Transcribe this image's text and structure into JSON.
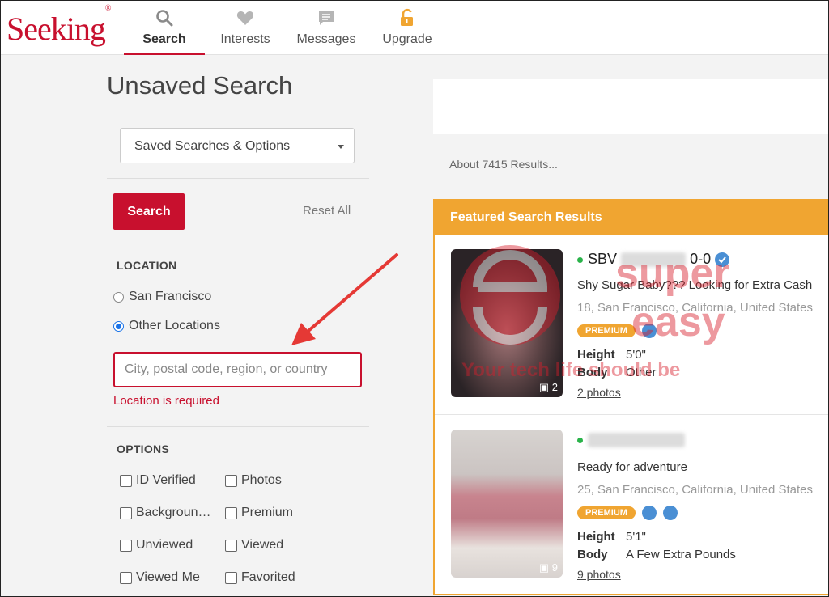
{
  "header": {
    "logo": "Seeking",
    "logo_mark": "®",
    "nav": [
      {
        "label": "Search",
        "icon": "search-icon"
      },
      {
        "label": "Interests",
        "icon": "heart-icon"
      },
      {
        "label": "Messages",
        "icon": "message-icon"
      },
      {
        "label": "Upgrade",
        "icon": "lock-icon"
      }
    ]
  },
  "left": {
    "title": "Unsaved Search",
    "dropdown_label": "Saved Searches & Options",
    "search_button": "Search",
    "reset_all": "Reset All",
    "location_label": "LOCATION",
    "radio_options": [
      "San Francisco",
      "Other Locations"
    ],
    "radio_selected": "Other Locations",
    "location_placeholder": "City, postal code, region, or country",
    "location_error": "Location is required",
    "options_label": "OPTIONS",
    "checkboxes": [
      "ID Verified",
      "Photos",
      "Backgroun…",
      "Premium",
      "Unviewed",
      "Viewed",
      "Viewed Me",
      "Favorited"
    ]
  },
  "right": {
    "results_count": "About 7415 Results...",
    "featured_title": "Featured Search Results",
    "cards": [
      {
        "username": "SBV",
        "username_suffix": "0-0",
        "headline": "Shy Sugar Baby??? Looking for Extra Cash",
        "location": "18, San Francisco, California, United States",
        "badge": "PREMIUM",
        "height_label": "Height",
        "height": "5'0\"",
        "body_label": "Body",
        "body": "Other",
        "photos": "2 photos",
        "photo_count": "2"
      },
      {
        "username": "",
        "username_suffix": "",
        "headline": "Ready for adventure",
        "location": "25, San Francisco, California, United States",
        "badge": "PREMIUM",
        "height_label": "Height",
        "height": "5'1\"",
        "body_label": "Body",
        "body": "A Few Extra Pounds",
        "photos": "9 photos",
        "photo_count": "9"
      }
    ]
  },
  "watermark": {
    "line1": "super",
    "line2": "easy",
    "line3": "Your tech life should be"
  },
  "colors": {
    "brand": "#c8102e",
    "featured": "#f0a531",
    "online": "#2ab34a",
    "verified": "#1a73e8"
  }
}
